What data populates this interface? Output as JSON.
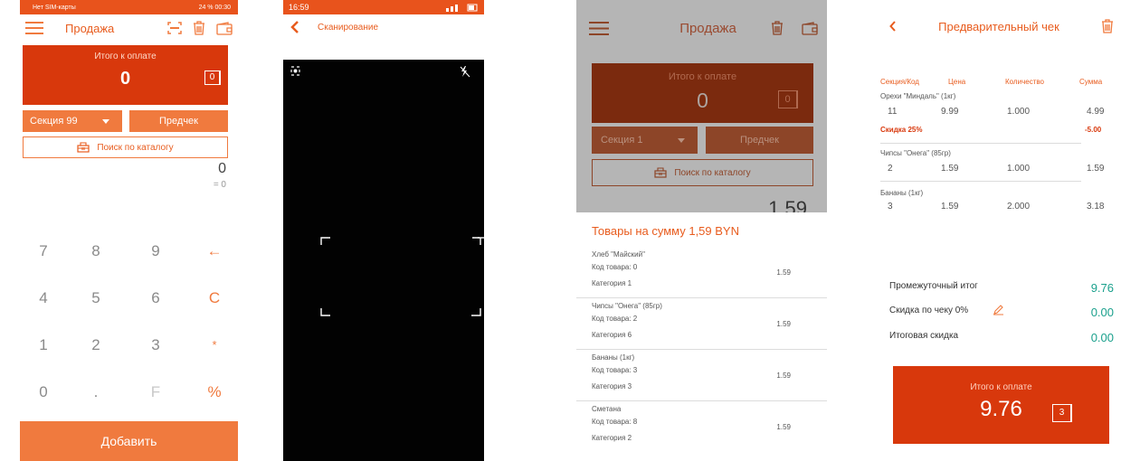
{
  "colors": {
    "accent": "#f07a3e",
    "accent_dark": "#d8380c",
    "teal": "#1aa08c"
  },
  "s1": {
    "status": {
      "left": "Нет SIM-карты",
      "right": "24 % 00:30"
    },
    "title": "Продажа",
    "total_label": "Итого к оплате",
    "total_value": "0",
    "items_count": "0",
    "section": "Секция 99",
    "precheck": "Предчек",
    "catalog_search": "Поиск по каталогу",
    "display_value": "0",
    "display_sub": "= 0",
    "keys": [
      "7",
      "8",
      "9",
      "←",
      "4",
      "5",
      "6",
      "C",
      "1",
      "2",
      "3",
      "*",
      "0",
      ".",
      "F",
      "%"
    ],
    "add_button": "Добавить"
  },
  "s2": {
    "time": "16:59",
    "title": "Сканирование"
  },
  "s3": {
    "title": "Продажа",
    "total_label": "Итого к оплате",
    "total_value": "0",
    "items_count": "0",
    "section": "Секция 1",
    "precheck": "Предчек",
    "catalog_search": "Поиск по каталогу",
    "partial_value": "1,59",
    "sheet_title": "Товары на сумму 1,59 BYN",
    "items": [
      {
        "name": "Хлеб \"Майский\"",
        "code": "Код товара: 0",
        "category": "Категория 1",
        "price": "1.59"
      },
      {
        "name": "Чипсы \"Онега\" (85гр)",
        "code": "Код товара: 2",
        "category": "Категория 6",
        "price": "1.59"
      },
      {
        "name": "Бананы (1кг)",
        "code": "Код товара: 3",
        "category": "Категория 3",
        "price": "1.59"
      },
      {
        "name": "Сметана",
        "code": "Код товара: 8",
        "category": "Категория 2",
        "price": "1.59"
      }
    ]
  },
  "s4": {
    "title": "Предварительный чек",
    "columns": {
      "section": "Секция/Код",
      "price": "Цена",
      "qty": "Количество",
      "sum": "Сумма"
    },
    "items": [
      {
        "name": "Орехи \"Миндаль\" (1кг)",
        "code": "11",
        "price": "9.99",
        "qty": "1.000",
        "sum": "4.99",
        "discount_label": "Скидка 25%",
        "discount_value": "-5.00"
      },
      {
        "name": "Чипсы \"Онега\" (85гр)",
        "code": "2",
        "price": "1.59",
        "qty": "1.000",
        "sum": "1.59"
      },
      {
        "name": "Бананы (1кг)",
        "code": "3",
        "price": "1.59",
        "qty": "2.000",
        "sum": "3.18"
      }
    ],
    "subtotal_label": "Промежуточный итог",
    "subtotal_value": "9.76",
    "check_discount_label": "Скидка по чеку 0%",
    "check_discount_value": "0.00",
    "total_discount_label": "Итоговая скидка",
    "total_discount_value": "0.00",
    "pay_label": "Итого к оплате",
    "pay_value": "9.76",
    "pay_count": "3"
  }
}
